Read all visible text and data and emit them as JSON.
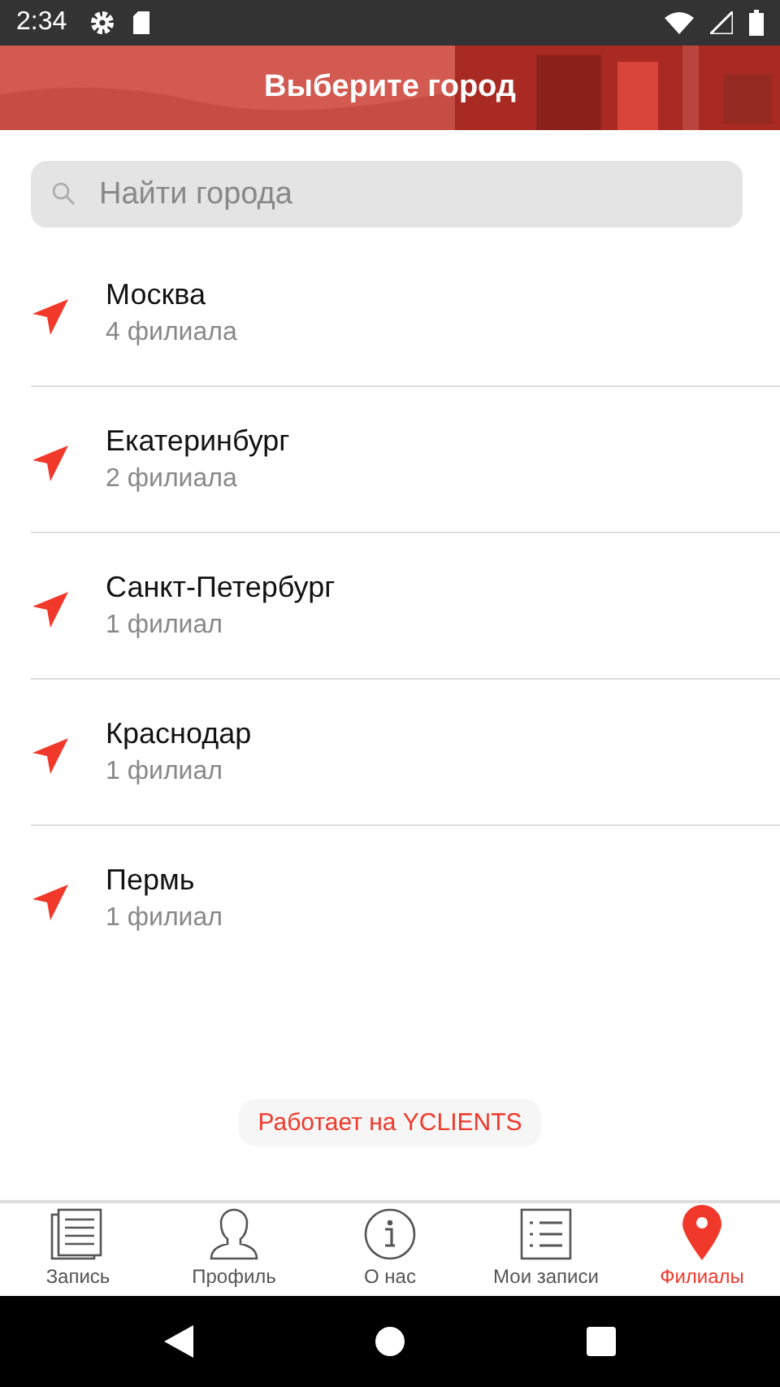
{
  "status_bar": {
    "time": "2:34"
  },
  "header": {
    "title": "Выберите город"
  },
  "search": {
    "placeholder": "Найти города"
  },
  "cities": [
    {
      "name": "Москва",
      "count": "4 филиала"
    },
    {
      "name": "Екатеринбург",
      "count": "2 филиала"
    },
    {
      "name": "Санкт-Петербург",
      "count": "1 филиал"
    },
    {
      "name": "Краснодар",
      "count": "1 филиал"
    },
    {
      "name": "Пермь",
      "count": "1 филиал"
    }
  ],
  "powered_by": "Работает на YCLIENTS",
  "tabs": [
    {
      "kind": "booking",
      "label": "Запись",
      "selected": false
    },
    {
      "kind": "profile",
      "label": "Профиль",
      "selected": false
    },
    {
      "kind": "about",
      "label": "О нас",
      "selected": false
    },
    {
      "kind": "records",
      "label": "Мои записи",
      "selected": false
    },
    {
      "kind": "branches",
      "label": "Филиалы",
      "selected": true
    }
  ]
}
